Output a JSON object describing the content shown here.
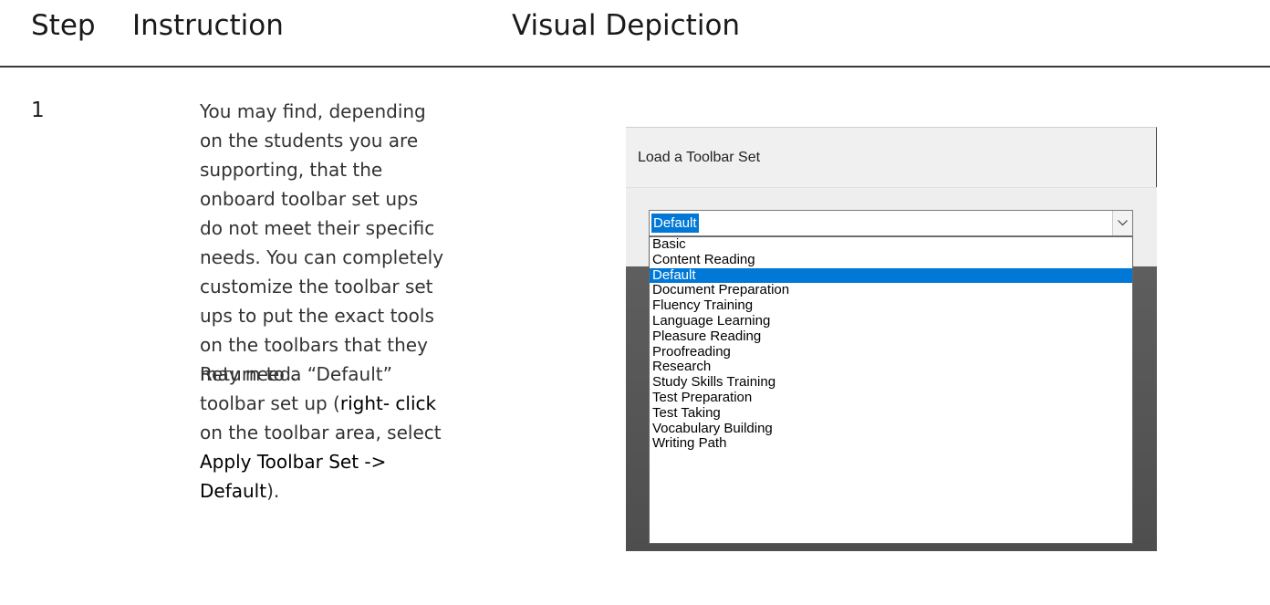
{
  "headers": {
    "step": "Step",
    "instruction": "Instruction",
    "visual": "Visual Depiction"
  },
  "row": {
    "step_number": "1",
    "paragraph1": "You may find, depending on the students you are supporting, that the onboard toolbar set ups do not meet their specific needs. You can completely customize the toolbar set ups to put the exact tools on the toolbars that they may need.",
    "paragraph2": {
      "t1": "Return to a “Default” toolbar set up (",
      "b1": "right- click",
      "t2": " on the toolbar area, select ",
      "b2": "Apply Toolbar Set -> Default",
      "t3": ")."
    }
  },
  "dialog": {
    "title": "Load a Toolbar Set",
    "combo_value": "Default",
    "options": [
      "Basic",
      "Content Reading",
      "Default",
      "Document Preparation",
      "Fluency Training",
      "Language Learning",
      "Pleasure Reading",
      "Proofreading",
      "Research",
      "Study Skills Training",
      "Test Preparation",
      "Test Taking",
      "Vocabulary Building",
      "Writing Path"
    ],
    "selected_option": "Default",
    "accent_color": "#0078d7"
  }
}
